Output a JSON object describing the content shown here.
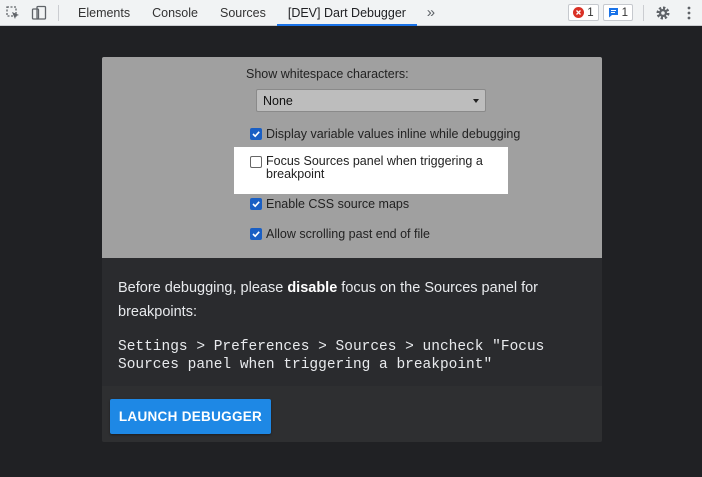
{
  "toolbar": {
    "tabs": [
      {
        "label": "Elements"
      },
      {
        "label": "Console"
      },
      {
        "label": "Sources"
      },
      {
        "label": "[DEV] Dart Debugger"
      }
    ],
    "active_tab": "[DEV] Dart Debugger",
    "error_count": "1",
    "message_count": "1",
    "icons": [
      "inspect-element-icon",
      "device-toolbar-icon",
      "more-tabs-icon",
      "error-icon",
      "message-icon",
      "settings-gear-icon",
      "kebab-menu-icon"
    ],
    "accent": "#1a73e8"
  },
  "settings_screenshot": {
    "whitespace_label": "Show whitespace characters:",
    "whitespace_value": "None",
    "options": [
      {
        "label": "Display variable values inline while debugging",
        "checked": true
      },
      {
        "label": "Focus Sources panel when triggering a breakpoint",
        "checked": false,
        "highlighted": true
      },
      {
        "label": "Enable CSS source maps",
        "checked": true
      },
      {
        "label": "Allow scrolling past end of file",
        "checked": true
      }
    ]
  },
  "message": {
    "prefix": "Before debugging, please ",
    "emphasis": "disable",
    "suffix": " focus on the Sources panel for breakpoints:",
    "instruction": "Settings > Preferences > Sources > uncheck \"Focus Sources panel when triggering a breakpoint\""
  },
  "launch_button": {
    "label": "LAUNCH DEBUGGER",
    "color": "#1e88e5"
  }
}
